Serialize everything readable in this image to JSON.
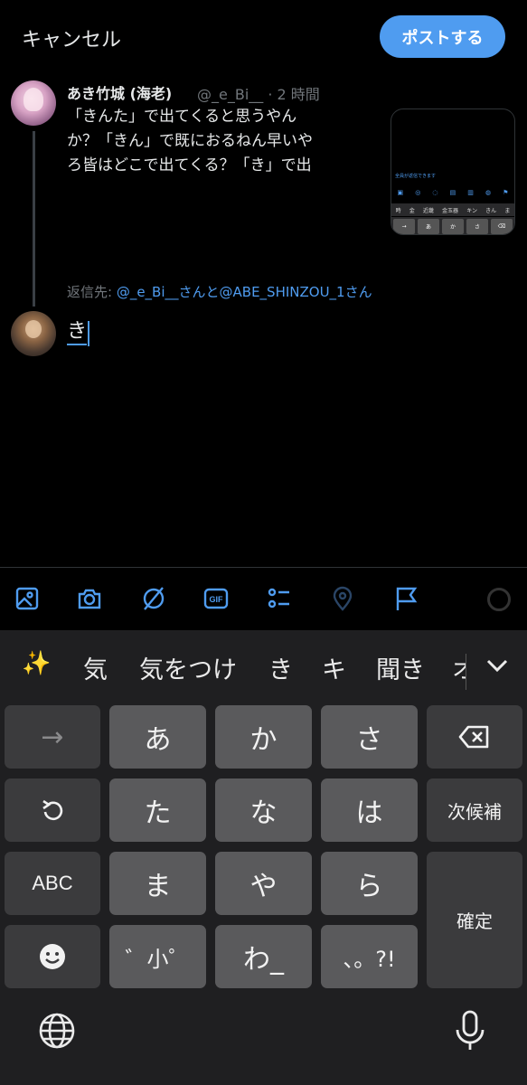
{
  "header": {
    "cancel_label": "キャンセル",
    "post_label": "ポストする"
  },
  "quoted": {
    "name": "あき竹城 (海老)",
    "handle": "@_e_Bi__ · 2 時間",
    "lines": [
      "「きんた」で出てくると思うやん",
      "か？「きん」で既におるねん早いや",
      "ろ皆はどこで出てくる？「き」で出"
    ],
    "thumb": {
      "banner": "全員が返信できます",
      "suggestions": [
        "時",
        "金",
        "近畿",
        "金玉器",
        "キン",
        "きん",
        "ま"
      ],
      "keys": [
        "→",
        "あ",
        "か",
        "さ",
        "⌫"
      ]
    },
    "reply_prefix": "返信先: ",
    "reply_users": "@_e_Bi__さんと@ABE_SHINZOU_1さん"
  },
  "compose": {
    "text": "き"
  },
  "toolbar": {
    "icons": [
      "image-icon",
      "camera-icon",
      "grok-icon",
      "gif-icon",
      "poll-icon",
      "location-icon",
      "flag-icon"
    ],
    "accent": "#4f9cf0"
  },
  "keyboard": {
    "suggestions": [
      "気",
      "気をつけ",
      "き",
      "キ",
      "聞き",
      "オ"
    ],
    "rows": [
      [
        "→",
        "あ",
        "か",
        "さ",
        "⌫"
      ],
      [
        "↺",
        "た",
        "な",
        "は",
        "次候補"
      ],
      [
        "ABC",
        "ま",
        "や",
        "ら",
        "確定"
      ],
      [
        "☻",
        "゛小゜",
        "わ_",
        "、。?!"
      ]
    ]
  }
}
